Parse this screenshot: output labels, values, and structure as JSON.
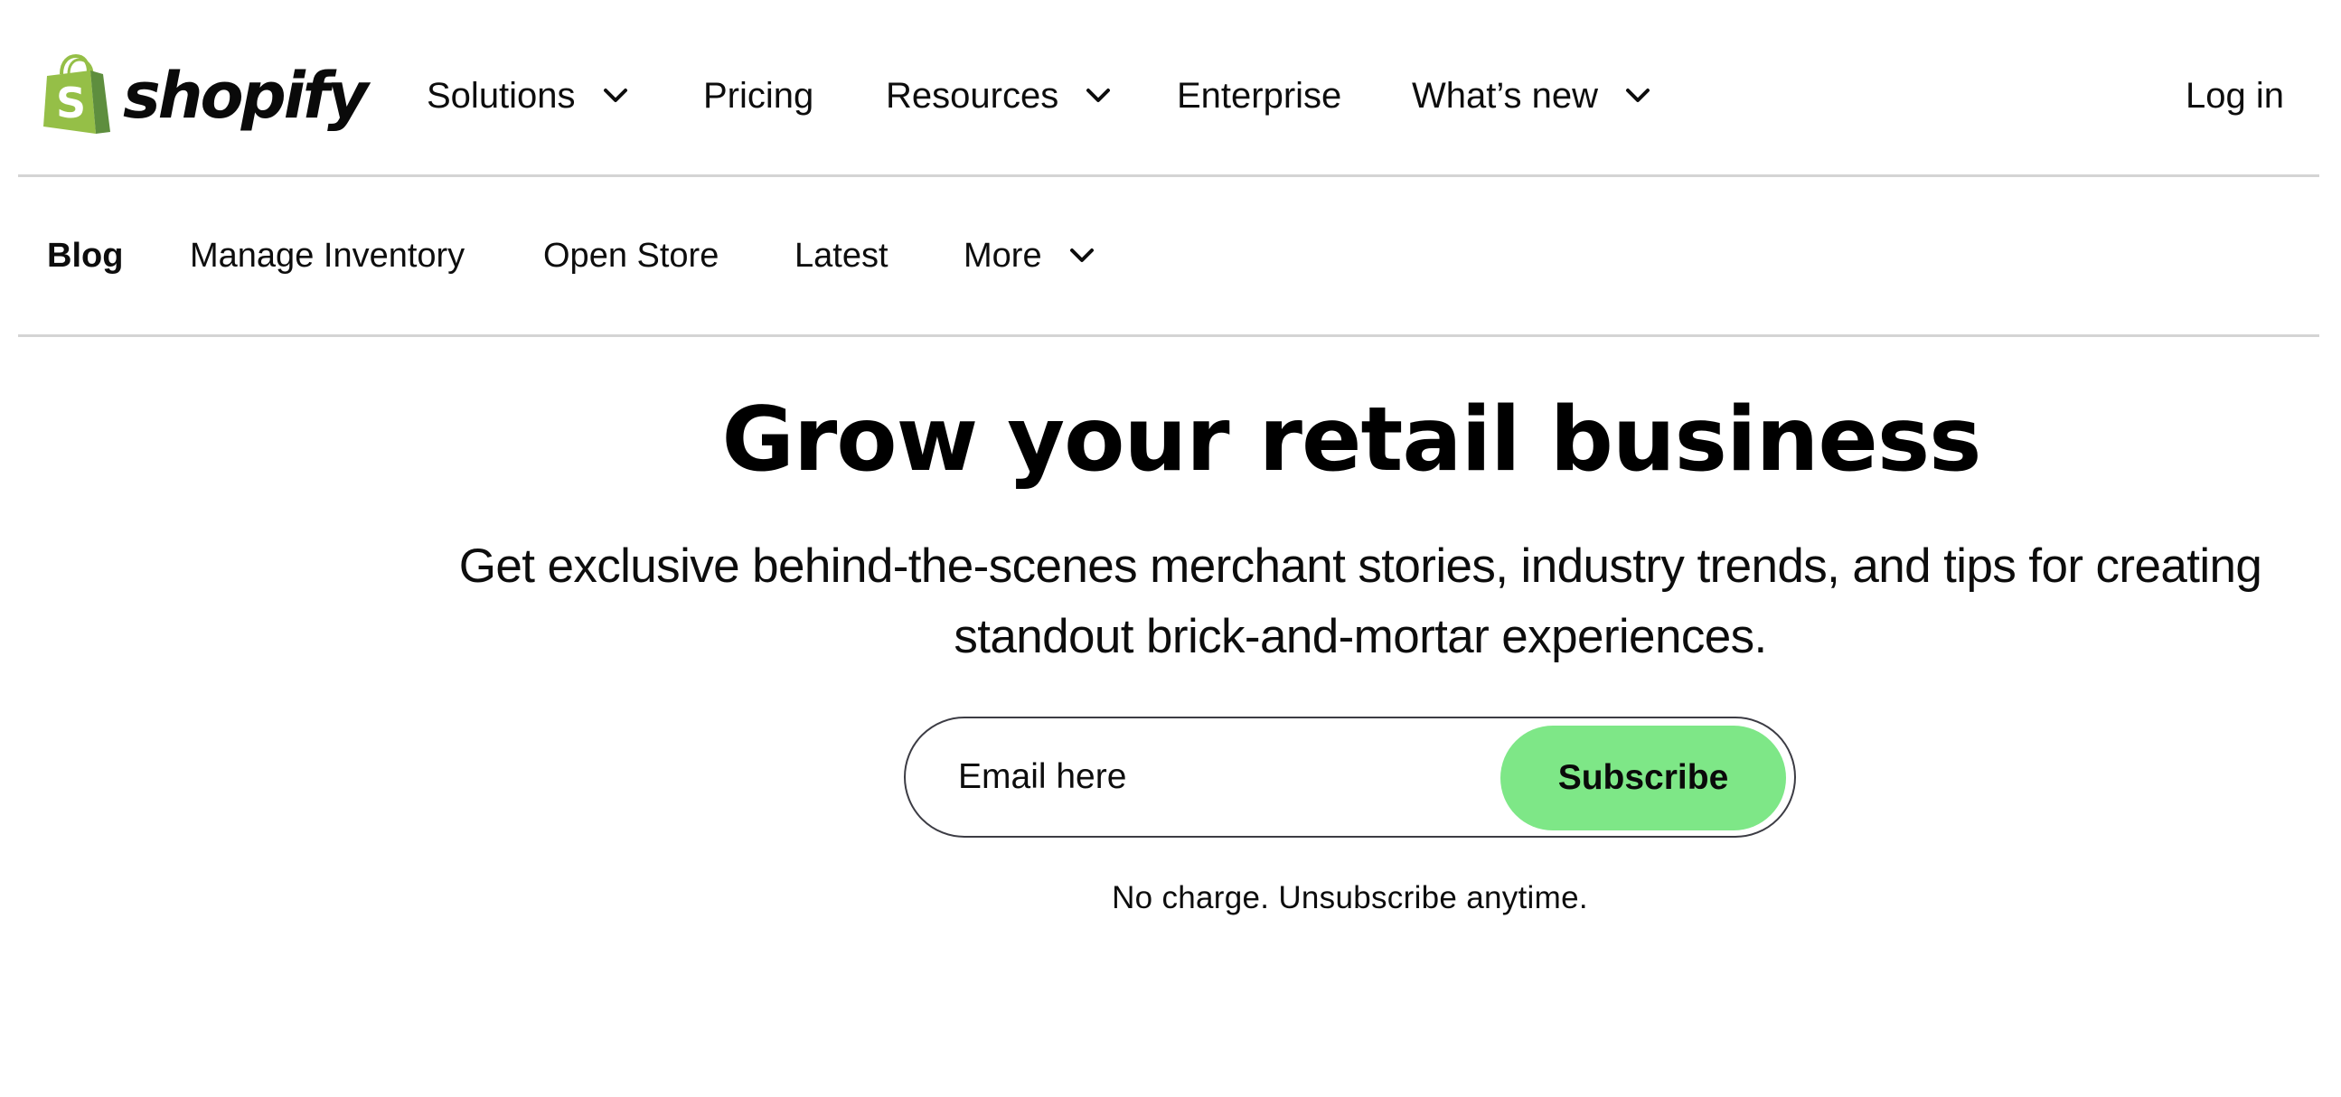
{
  "brand": {
    "name": "shopify",
    "logo_icon": "shopping-bag-icon",
    "colors": {
      "bag_light": "#95BF47",
      "bag_dark": "#5E8E3E",
      "accent_green": "#7EE787",
      "text": "#0D0D0D",
      "divider": "#D4D4D4",
      "input_border": "#3C3C44"
    }
  },
  "top_nav": {
    "items": [
      {
        "label": "Solutions",
        "has_dropdown": true,
        "icon": "chevron-down-icon"
      },
      {
        "label": "Pricing",
        "has_dropdown": false
      },
      {
        "label": "Resources",
        "has_dropdown": true,
        "icon": "chevron-down-icon"
      },
      {
        "label": "Enterprise",
        "has_dropdown": false
      },
      {
        "label": "What’s new",
        "has_dropdown": true,
        "icon": "chevron-down-icon"
      }
    ],
    "login_label": "Log in"
  },
  "sub_nav": {
    "items": [
      {
        "label": "Blog",
        "active": true
      },
      {
        "label": "Manage Inventory",
        "active": false
      },
      {
        "label": "Open Store",
        "active": false
      },
      {
        "label": "Latest",
        "active": false
      },
      {
        "label": "More",
        "active": false,
        "has_dropdown": true,
        "icon": "chevron-down-icon"
      }
    ]
  },
  "hero": {
    "title": "Grow your retail business",
    "subtitle": "Get exclusive behind-the-scenes merchant stories, industry trends, and tips for creating standout brick-and-mortar experiences.",
    "email_placeholder": "Email here",
    "email_value": "",
    "subscribe_label": "Subscribe",
    "fine_print": "No charge. Unsubscribe anytime."
  }
}
